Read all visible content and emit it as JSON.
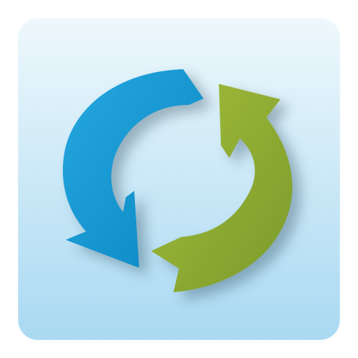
{
  "icon": {
    "semantic": "sync-arrows-icon",
    "colors": {
      "page_background": "#ffffff",
      "tile_top": "#eef8fc",
      "tile_bottom": "#a9d9f2",
      "blue_arrow_light": "#26a8e0",
      "blue_arrow_dark": "#0a86c2",
      "green_arrow_light": "#a2be3c",
      "green_arrow_dark": "#7b9a2a",
      "shadow": "#1d3b4e"
    }
  }
}
